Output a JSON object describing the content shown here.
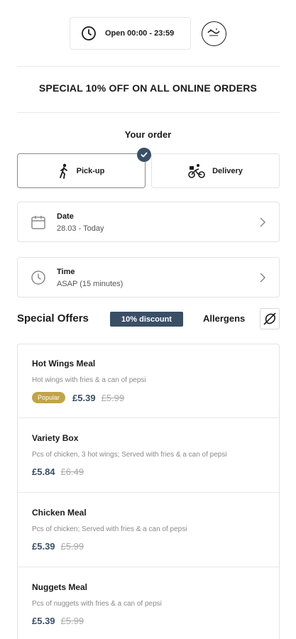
{
  "header": {
    "hours": "Open 00:00 - 23:59",
    "halal_icon": "halal-icon"
  },
  "promo": "SPECIAL 10% OFF ON ALL ONLINE ORDERS",
  "order": {
    "title": "Your order",
    "modes": [
      {
        "label": "Pick-up",
        "icon": "walking-person-icon",
        "selected": true
      },
      {
        "label": "Delivery",
        "icon": "delivery-bike-icon",
        "selected": false
      }
    ],
    "date": {
      "label": "Date",
      "value": "28.03 - Today"
    },
    "time": {
      "label": "Time",
      "value": "ASAP (15 minutes)"
    }
  },
  "offers": {
    "title": "Special Offers",
    "badge": "10% discount",
    "allergens_label": "Allergens",
    "items": [
      {
        "name": "Hot Wings Meal",
        "description": "Hot wings with fries & a can of pepsi",
        "tag": "Popular",
        "price": "£5.39",
        "old_price": "£5.99"
      },
      {
        "name": "Variety Box",
        "description": "Pcs of chicken, 3 hot wings; Served with fries & a can of pepsi",
        "tag": "",
        "price": "£5.84",
        "old_price": "£6.49"
      },
      {
        "name": "Chicken Meal",
        "description": "Pcs of chicken; Served with fries & a can of pepsi",
        "tag": "",
        "price": "£5.39",
        "old_price": "£5.99"
      },
      {
        "name": "Nuggets Meal",
        "description": "Pcs of nuggets with fries & a can of pepsi",
        "tag": "",
        "price": "£5.39",
        "old_price": "£5.99"
      }
    ]
  },
  "colors": {
    "accent": "#3a4f66",
    "popular": "#c1a34a",
    "border": "#e3e3e3"
  }
}
